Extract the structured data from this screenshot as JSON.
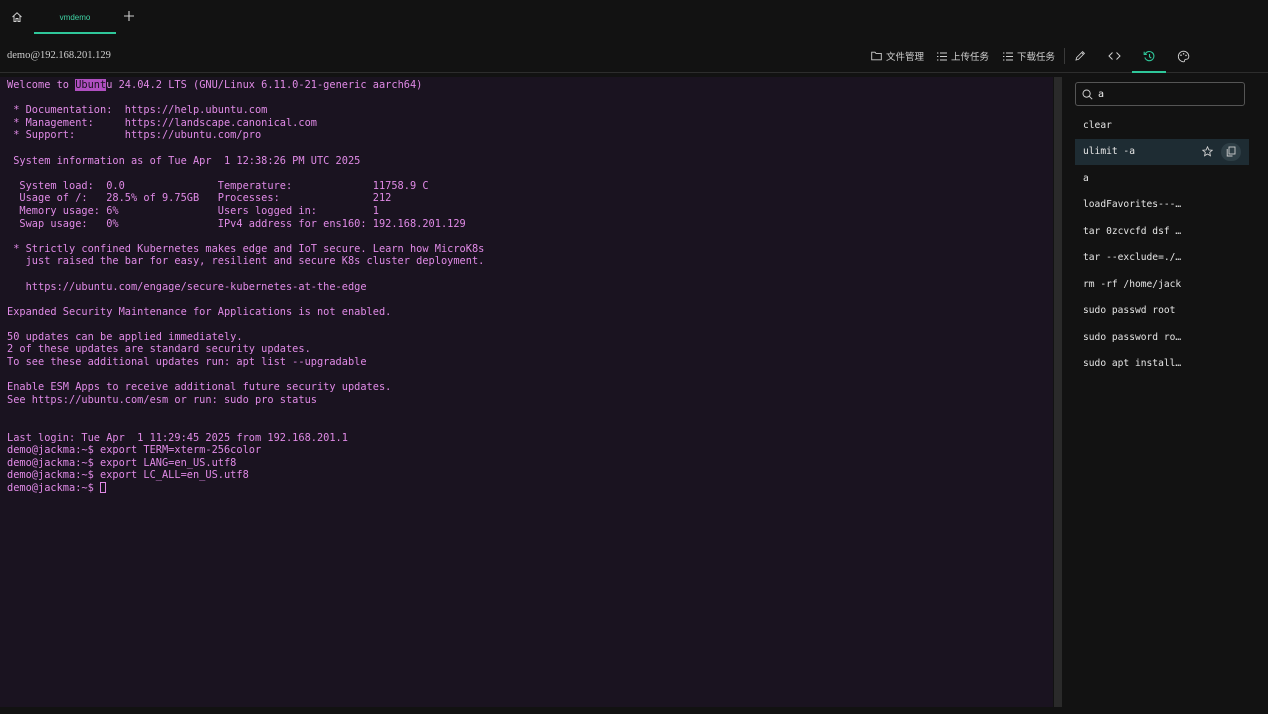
{
  "tabs": [
    {
      "label": "vmdemo",
      "active": true
    }
  ],
  "toolbar": {
    "host": "demo@192.168.201.129",
    "file_manager": "文件管理",
    "upload_tasks": "上传任务",
    "download_tasks": "下载任务"
  },
  "terminal": {
    "lines": [
      "Welcome to Ubuntu 24.04.2 LTS (GNU/Linux 6.11.0-21-generic aarch64)",
      "",
      " * Documentation:  https://help.ubuntu.com",
      " * Management:     https://landscape.canonical.com",
      " * Support:        https://ubuntu.com/pro",
      "",
      " System information as of Tue Apr  1 12:38:26 PM UTC 2025",
      "",
      "  System load:  0.0               Temperature:             11758.9 C",
      "  Usage of /:   28.5% of 9.75GB   Processes:               212",
      "  Memory usage: 6%                Users logged in:         1",
      "  Swap usage:   0%                IPv4 address for ens160: 192.168.201.129",
      "",
      " * Strictly confined Kubernetes makes edge and IoT secure. Learn how MicroK8s",
      "   just raised the bar for easy, resilient and secure K8s cluster deployment.",
      "",
      "   https://ubuntu.com/engage/secure-kubernetes-at-the-edge",
      "",
      "Expanded Security Maintenance for Applications is not enabled.",
      "",
      "50 updates can be applied immediately.",
      "2 of these updates are standard security updates.",
      "To see these additional updates run: apt list --upgradable",
      "",
      "Enable ESM Apps to receive additional future security updates.",
      "See https://ubuntu.com/esm or run: sudo pro status",
      "",
      "",
      "Last login: Tue Apr  1 11:29:45 2025 from 192.168.201.1",
      "demo@jackma:~$ export TERM=xterm-256color",
      "demo@jackma:~$ export LANG=en_US.utf8",
      "demo@jackma:~$ export LC_ALL=en_US.utf8",
      "demo@jackma:~$ "
    ],
    "highlight": {
      "line": 0,
      "before": "Welcome to ",
      "marked": "Ubunt",
      "after": "u 24.04.2 LTS (GNU/Linux 6.11.0-21-generic aarch64)"
    }
  },
  "history": {
    "search_value": "a",
    "items": [
      "clear",
      "ulimit -a",
      "a",
      "loadFavorites---…",
      "tar 0zcvcfd dsf …",
      "tar --exclude=./…",
      "rm -rf /home/jack",
      "sudo passwd root",
      "sudo password ro…",
      "sudo apt install…"
    ],
    "selected_index": 1
  },
  "colors": {
    "accent": "#2fc79a",
    "terminal_text": "#e08ae6",
    "terminal_bg": "#1a1320"
  }
}
